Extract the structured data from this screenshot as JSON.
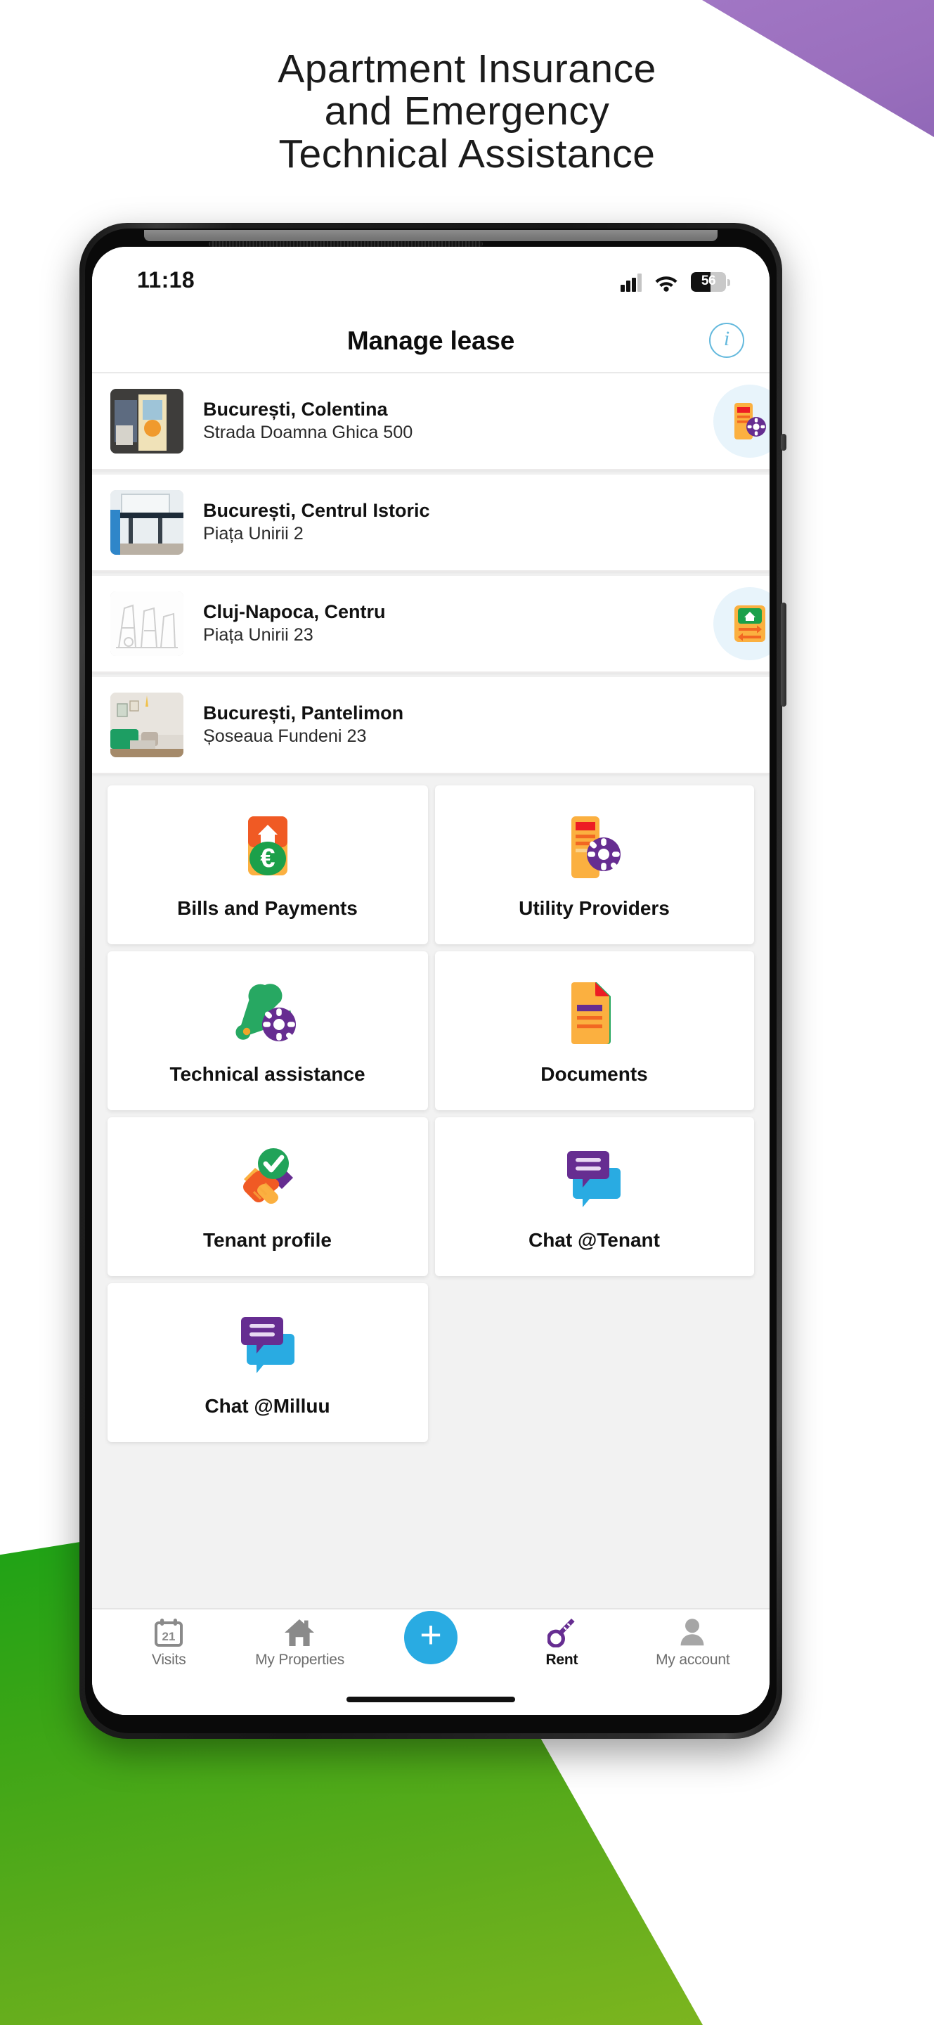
{
  "hero": {
    "headline_lines": [
      "Apartment Insurance",
      "and Emergency",
      "Technical Assistance"
    ]
  },
  "colors": {
    "purple_corner": "#9a6fbd",
    "green_corner": "#3ba516",
    "accent_blue": "#29abe2",
    "info_blue": "#64b9dd",
    "badge_bg": "#e8f4fb",
    "icon_orange": "#f7941e",
    "icon_red": "#ed1c24",
    "icon_purple": "#662d91",
    "icon_green": "#1ca04a",
    "icon_teal_blue": "#29abe2"
  },
  "phone": {
    "status_bar": {
      "time": "11:18",
      "signal_icon": "signal-bars-icon",
      "wifi_icon": "wifi-icon",
      "battery_level": "56",
      "battery_icon": "battery-icon"
    },
    "header": {
      "title": "Manage lease",
      "info_label": "i",
      "info_icon": "info-circle-icon"
    },
    "properties": [
      {
        "title": "București, Colentina",
        "address": "Strada Doamna Ghica 500",
        "thumb_icon": "property-photo-thumbnail",
        "badge_icon": "utility-providers-icon",
        "has_badge": true
      },
      {
        "title": "București, Centrul Istoric",
        "address": "Piața Unirii 2",
        "thumb_icon": "property-photo-thumbnail",
        "badge_icon": "",
        "has_badge": false
      },
      {
        "title": "Cluj-Napoca, Centru",
        "address": "Piața Unirii 23",
        "thumb_icon": "property-sketch-thumbnail",
        "badge_icon": "move-in-out-icon",
        "has_badge": true
      },
      {
        "title": "București, Pantelimon",
        "address": "Șoseaua Fundeni 23",
        "thumb_icon": "property-photo-thumbnail",
        "badge_icon": "",
        "has_badge": false
      }
    ],
    "tiles": [
      {
        "label": "Bills and Payments",
        "icon": "bills-and-payments-icon"
      },
      {
        "label": "Utility Providers",
        "icon": "utility-providers-icon"
      },
      {
        "label": "Technical assistance",
        "icon": "wrench-gear-icon"
      },
      {
        "label": "Documents",
        "icon": "documents-icon"
      },
      {
        "label": "Tenant profile",
        "icon": "handshake-check-icon"
      },
      {
        "label": "Chat @Tenant",
        "icon": "chat-bubbles-icon"
      },
      {
        "label": "Chat @Milluu",
        "icon": "chat-bubbles-icon"
      }
    ],
    "bottom_nav": [
      {
        "label": "Visits",
        "icon": "calendar-icon",
        "badge": "21",
        "active": false
      },
      {
        "label": "My Properties",
        "icon": "house-icon",
        "active": false
      },
      {
        "label": "",
        "icon": "plus-fab-icon",
        "fab_label": "+",
        "active": false
      },
      {
        "label": "Rent",
        "icon": "key-icon",
        "active": true
      },
      {
        "label": "My account",
        "icon": "person-icon",
        "active": false
      }
    ]
  }
}
